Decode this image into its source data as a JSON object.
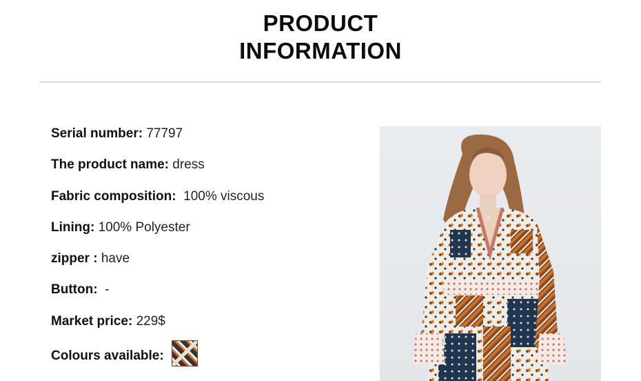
{
  "header": {
    "title_line1": "PRODUCT",
    "title_line2": "INFORMATION"
  },
  "specs": [
    {
      "label": "Serial number:",
      "value": "77797"
    },
    {
      "label": "The product name:",
      "value": "dress"
    },
    {
      "label": "Fabric composition:",
      "value": "100% viscous"
    },
    {
      "label": "Lining:",
      "value": "100% Polyester"
    },
    {
      "label": "zipper :",
      "value": "have"
    },
    {
      "label": "Button:",
      "value": "-"
    },
    {
      "label": "Market price:",
      "value": "229$"
    },
    {
      "label": "Colours available:",
      "value": ""
    }
  ],
  "colors": {
    "text": "#111111",
    "divider": "#dcdcdc",
    "photo_background": "#e9ecef",
    "dress_brown": "#8a4a22",
    "dress_navy": "#1f3550",
    "dress_cream": "#f1ece3"
  }
}
